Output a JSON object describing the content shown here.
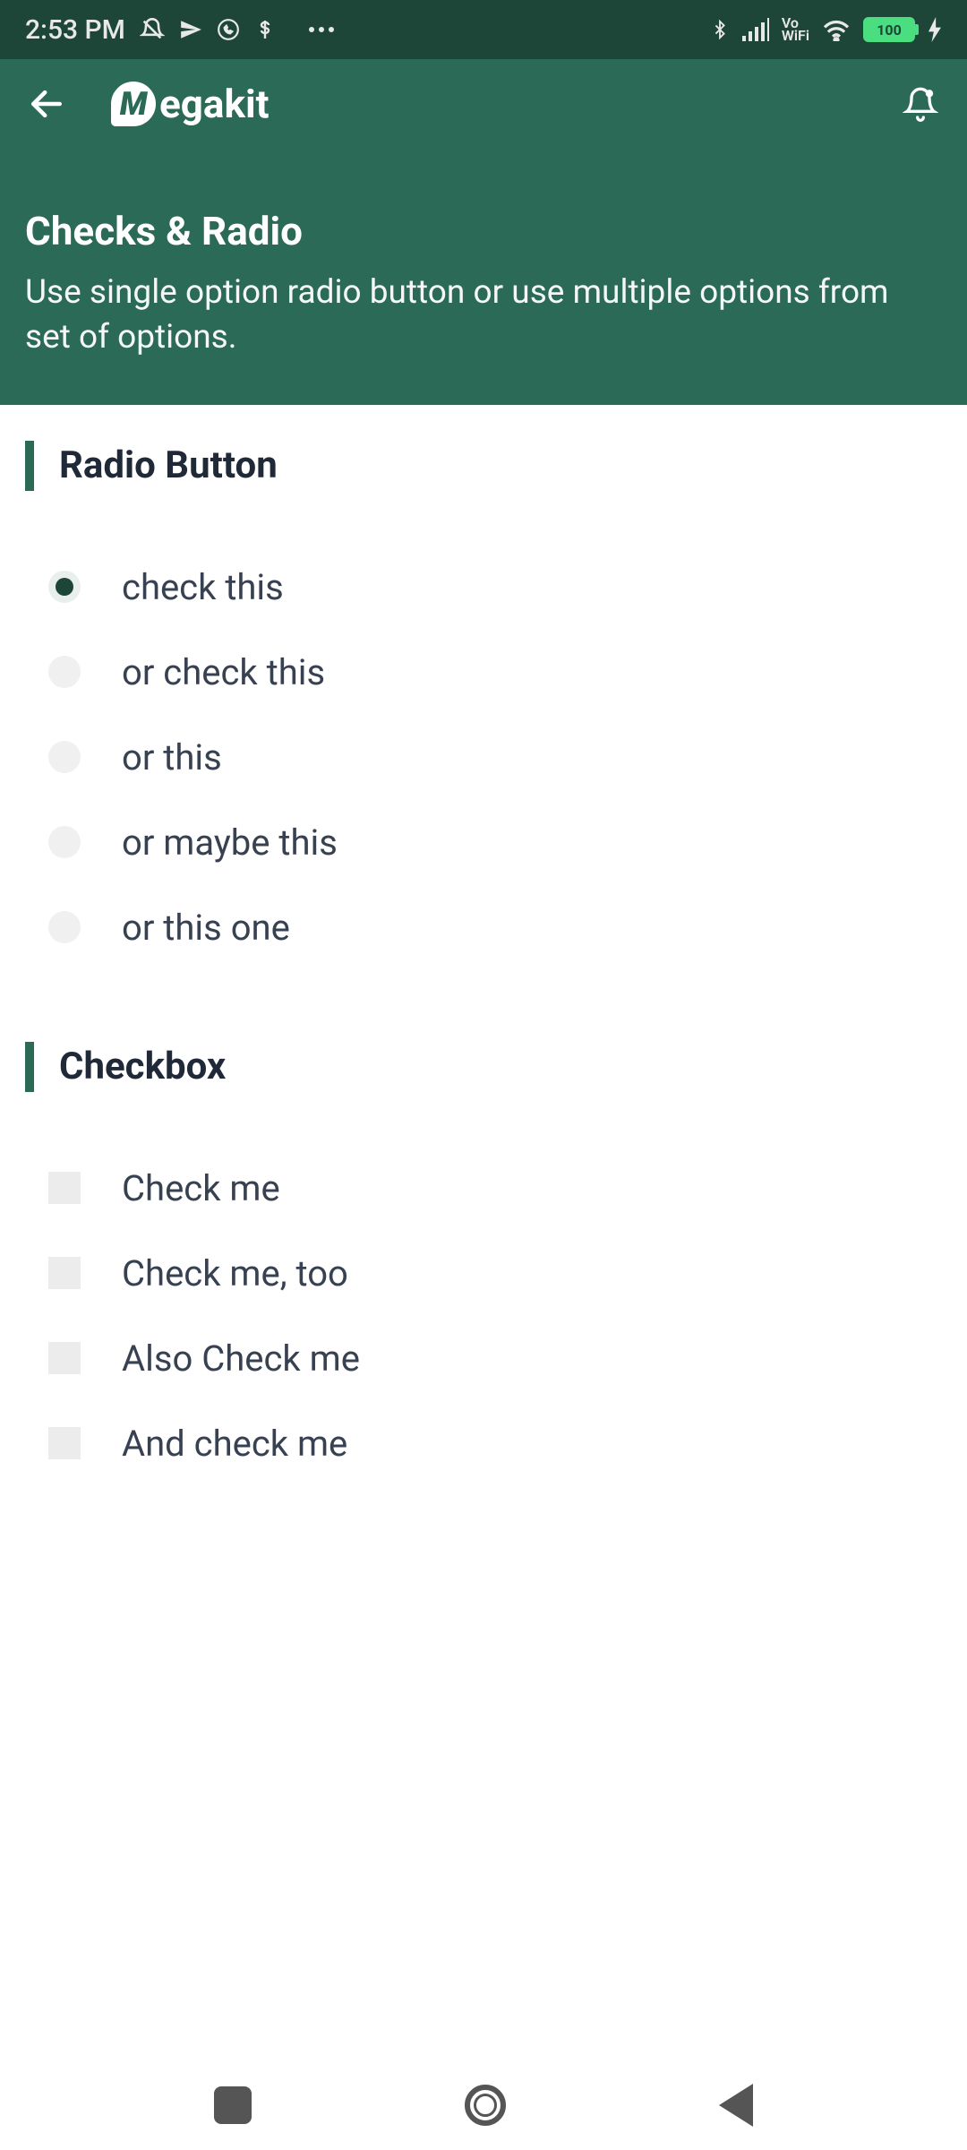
{
  "statusbar": {
    "time": "2:53 PM",
    "battery": "100",
    "vo": "Vo",
    "wifi_label": "WiFi"
  },
  "header": {
    "app_name": "egakit",
    "title": "Checks & Radio",
    "subtitle": "Use single option radio button or use multiple options from set of options."
  },
  "sections": {
    "radio": {
      "heading": "Radio Button",
      "options": [
        {
          "label": "check this",
          "selected": true
        },
        {
          "label": "or check this",
          "selected": false
        },
        {
          "label": "or this",
          "selected": false
        },
        {
          "label": "or maybe this",
          "selected": false
        },
        {
          "label": "or this one",
          "selected": false
        }
      ]
    },
    "checkbox": {
      "heading": "Checkbox",
      "options": [
        {
          "label": "Check me",
          "checked": false
        },
        {
          "label": "Check me,  too",
          "checked": false
        },
        {
          "label": "Also Check me",
          "checked": false
        },
        {
          "label": "And check me",
          "checked": false
        }
      ]
    }
  },
  "icons": {
    "back": "arrow-left-icon",
    "bell": "bell-icon",
    "mute": "mute-icon",
    "send": "send-icon",
    "whatsapp": "whatsapp-icon",
    "misc": "s-icon",
    "more": "more-icon",
    "bluetooth": "bluetooth-icon",
    "signal": "signal-icon",
    "wifi": "wifi-icon",
    "bolt": "bolt-icon"
  }
}
